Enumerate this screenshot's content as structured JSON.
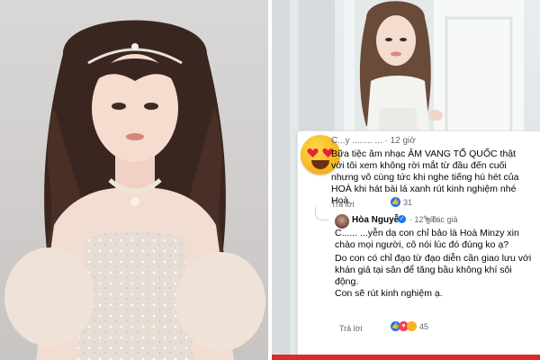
{
  "comment1": {
    "name": "C...y ........ ...",
    "time": "12 giờ",
    "text": "Bữa tiệc âm nhạc ÂM VANG TỔ QUỐC thật với tôi xem không rời mắt từ đầu đến cuối nhưng vô cùng tức khi nghe tiếng hú hét của HOÀ khi hát bài lá xanh rút kinh nghiệm nhé Hoà",
    "reply_label": "Trả lời",
    "reaction_count": "31"
  },
  "comment2": {
    "name": "Hòa Nguyễn",
    "time": "12 giờ",
    "author_label": "Tác giả",
    "text_line1": "C...... ...yễn dạ con chỉ bảo là Hoà Minzy xin chào mọi người, cô nói lúc đó đúng ko ạ?",
    "text_line2": "Do con có chỉ đạo từ đạo diễn cần giao lưu với khán giả tại sân để tăng bầu không khí sôi động.",
    "text_line3": "Con sẽ rút kinh nghiệm ạ.",
    "reply_label": "Trả lời",
    "reaction_count": "45"
  },
  "colors": {
    "accent": "#1877f2",
    "love": "#f33e58",
    "bar": "#d82c2c"
  }
}
